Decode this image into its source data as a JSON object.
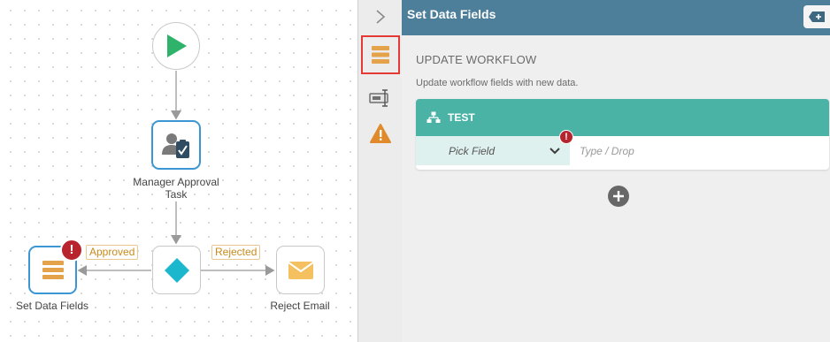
{
  "canvas": {
    "nodes": {
      "start": {
        "icon": "play-icon"
      },
      "manager_approval": {
        "label_line1": "Manager Approval",
        "label_line2": "Task",
        "icon": "user-approval-icon"
      },
      "decision": {
        "icon": "diamond-icon"
      },
      "set_data_fields": {
        "label": "Set Data Fields",
        "icon": "data-fields-icon",
        "error": "!"
      },
      "reject_email": {
        "label": "Reject Email",
        "icon": "envelope-icon"
      }
    },
    "edges": {
      "approved": "Approved",
      "rejected": "Rejected"
    }
  },
  "toolstrip": {
    "collapse_icon": "chevron-right-icon",
    "tools": [
      {
        "name": "data-fields-icon",
        "selected": true
      },
      {
        "name": "form-field-icon",
        "selected": false
      },
      {
        "name": "warning-icon",
        "selected": false
      }
    ]
  },
  "panel": {
    "title": "Set Data Fields",
    "action_icon": "add-tag-icon",
    "section_title": "UPDATE WORKFLOW",
    "section_description": "Update workflow fields with new data.",
    "card": {
      "name": "TEST",
      "icon": "workflow-tree-icon",
      "pick_field": "Pick Field",
      "value_placeholder": "Type / Drop",
      "error": "!"
    },
    "add_icon": "plus-circle-icon"
  },
  "colors": {
    "panel_header": "#4d7e9a",
    "card_header": "#4ab3a6",
    "accent_orange": "#e4a24a",
    "error": "#b8242d",
    "start_green": "#2fb36a",
    "decision_teal": "#1ab7cd",
    "selected_outline": "#e53935"
  }
}
